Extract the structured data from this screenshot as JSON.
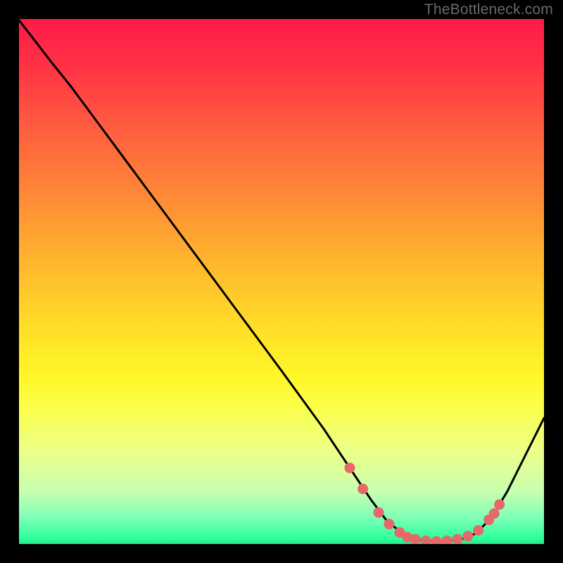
{
  "attribution": "TheBottleneck.com",
  "chart_data": {
    "type": "line",
    "title": "",
    "xlabel": "",
    "ylabel": "",
    "xlim": [
      0,
      100
    ],
    "ylim": [
      0,
      100
    ],
    "curve": [
      {
        "x": 0.0,
        "y": 99.8
      },
      {
        "x": 6.0,
        "y": 92.0
      },
      {
        "x": 10.0,
        "y": 87.0
      },
      {
        "x": 20.0,
        "y": 73.5
      },
      {
        "x": 30.0,
        "y": 60.0
      },
      {
        "x": 40.0,
        "y": 46.5
      },
      {
        "x": 50.0,
        "y": 33.0
      },
      {
        "x": 58.0,
        "y": 22.0
      },
      {
        "x": 63.0,
        "y": 14.5
      },
      {
        "x": 67.0,
        "y": 8.5
      },
      {
        "x": 70.0,
        "y": 4.5
      },
      {
        "x": 73.0,
        "y": 2.0
      },
      {
        "x": 76.0,
        "y": 0.8
      },
      {
        "x": 80.0,
        "y": 0.5
      },
      {
        "x": 84.0,
        "y": 0.8
      },
      {
        "x": 87.0,
        "y": 2.0
      },
      {
        "x": 90.0,
        "y": 5.0
      },
      {
        "x": 93.0,
        "y": 10.0
      },
      {
        "x": 96.0,
        "y": 16.0
      },
      {
        "x": 100.0,
        "y": 24.0
      }
    ],
    "markers": [
      {
        "x": 63.0,
        "y": 14.5
      },
      {
        "x": 65.5,
        "y": 10.5
      },
      {
        "x": 68.5,
        "y": 6.0
      },
      {
        "x": 70.5,
        "y": 3.8
      },
      {
        "x": 72.5,
        "y": 2.2
      },
      {
        "x": 74.0,
        "y": 1.3
      },
      {
        "x": 75.5,
        "y": 0.9
      },
      {
        "x": 77.5,
        "y": 0.6
      },
      {
        "x": 79.5,
        "y": 0.5
      },
      {
        "x": 81.5,
        "y": 0.6
      },
      {
        "x": 83.5,
        "y": 0.9
      },
      {
        "x": 85.5,
        "y": 1.5
      },
      {
        "x": 87.5,
        "y": 2.6
      },
      {
        "x": 89.5,
        "y": 4.6
      },
      {
        "x": 90.5,
        "y": 5.8
      },
      {
        "x": 91.5,
        "y": 7.5
      }
    ],
    "colors": {
      "curve": "#000000",
      "marker_fill": "#e46a6a",
      "marker_stroke": "#b94f4f",
      "frame": "#000000"
    }
  }
}
